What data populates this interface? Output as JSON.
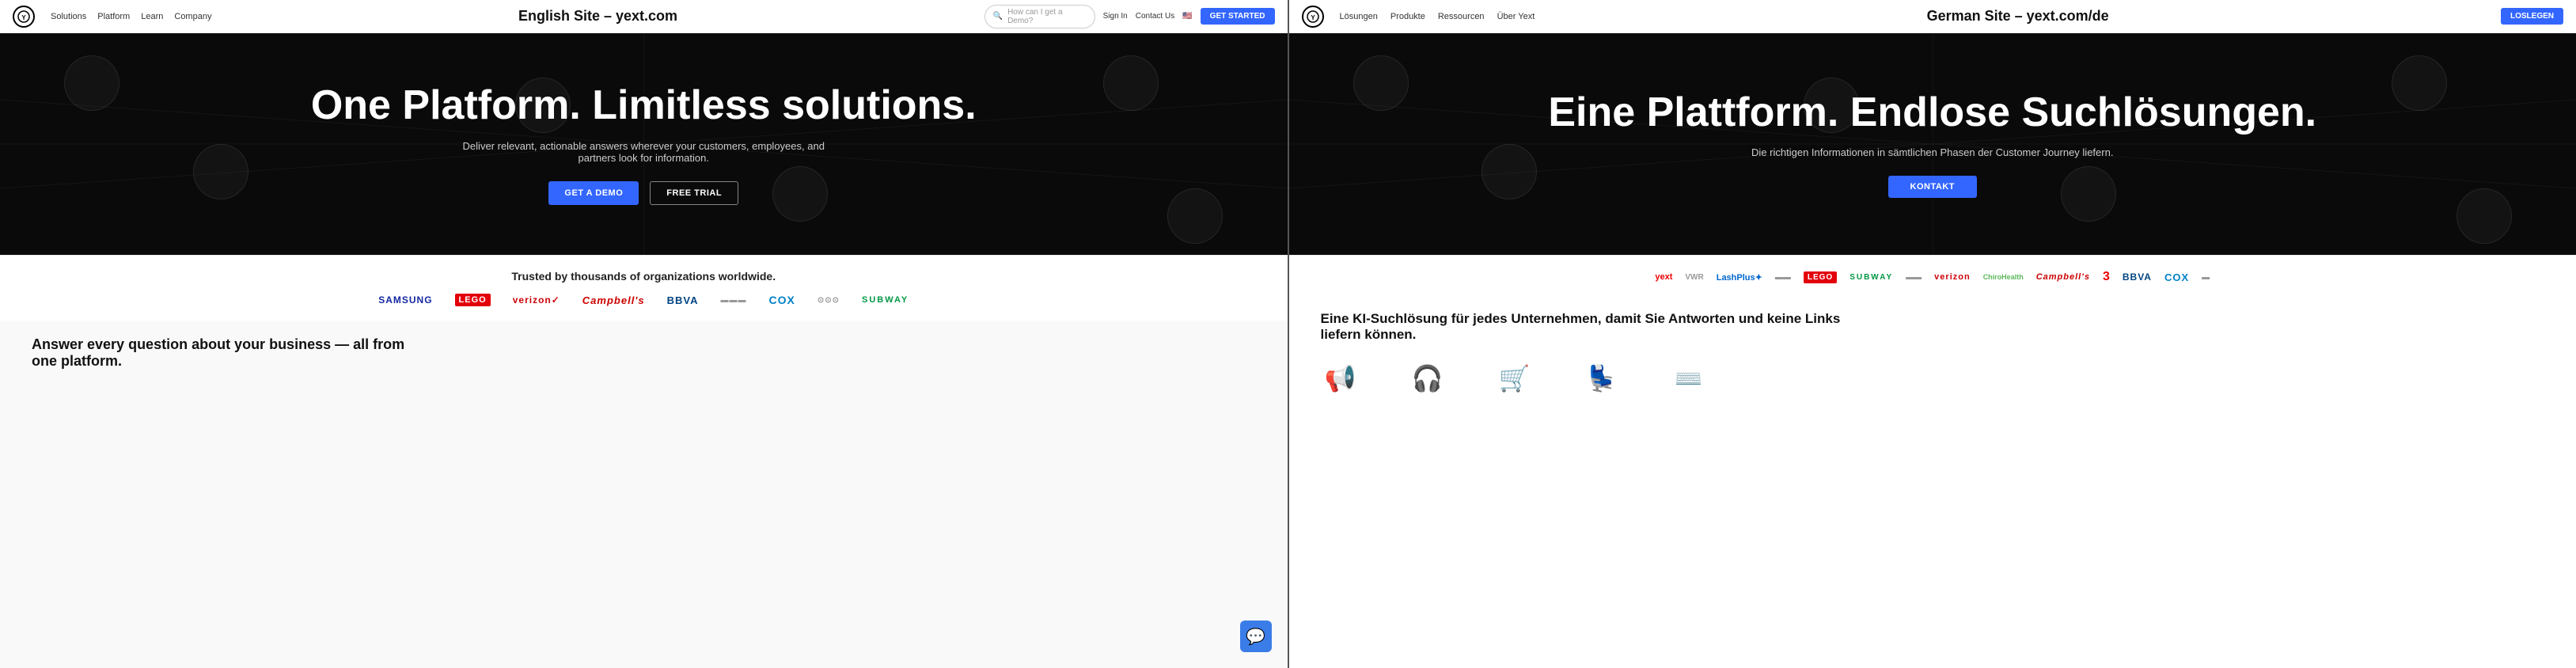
{
  "english": {
    "nav": {
      "logo_text": "YE",
      "links": [
        "Solutions",
        "Platform",
        "Learn",
        "Company"
      ],
      "center_label": "English Site – yext.com",
      "search_placeholder": "How can I get a Demo?",
      "right_links": [
        "Sign In",
        "Contact Us"
      ],
      "cta_label": "GET STARTED"
    },
    "hero": {
      "title": "One Platform. Limitless solutions.",
      "subtitle": "Deliver relevant, actionable answers wherever your customers, employees, and partners look for information.",
      "btn_demo": "GET A DEMO",
      "btn_trial": "FREE TRIAL"
    },
    "trusted": {
      "title": "Trusted by thousands of organizations worldwide.",
      "logos": [
        "SAMSUNG",
        "LEGO",
        "verizon",
        "Campbell's",
        "BBVA",
        "",
        "COX",
        "",
        "SUBWAY"
      ]
    },
    "bottom": {
      "title": "Answer every question about your business — all from one platform."
    }
  },
  "german": {
    "nav": {
      "logo_text": "YE",
      "links": [
        "Lösungen",
        "Produkte",
        "Ressourcen",
        "Über Yext"
      ],
      "center_label": "German Site – yext.com/de",
      "cta_label": "LOSLEGEN"
    },
    "hero": {
      "title": "Eine Plattform. Endlose Suchlösungen.",
      "subtitle": "Die richtigen Informationen in sämtlichen Phasen der Customer Journey liefern.",
      "btn_kontakt": "KONTAKT"
    },
    "trusted": {
      "logos": [
        "yext",
        "VWR",
        "LashPlus",
        "",
        "LEGO",
        "SUBWAY",
        "",
        "verizon",
        "ChiroHealth",
        "Campbell's",
        "3",
        "BBVA",
        "COX",
        ""
      ]
    },
    "bottom": {
      "title": "Eine KI-Suchlösung für jedes Unternehmen, damit Sie Antworten und keine Links liefern können.",
      "icons": [
        "megaphone",
        "headset",
        "cart",
        "chair",
        "code"
      ]
    }
  }
}
